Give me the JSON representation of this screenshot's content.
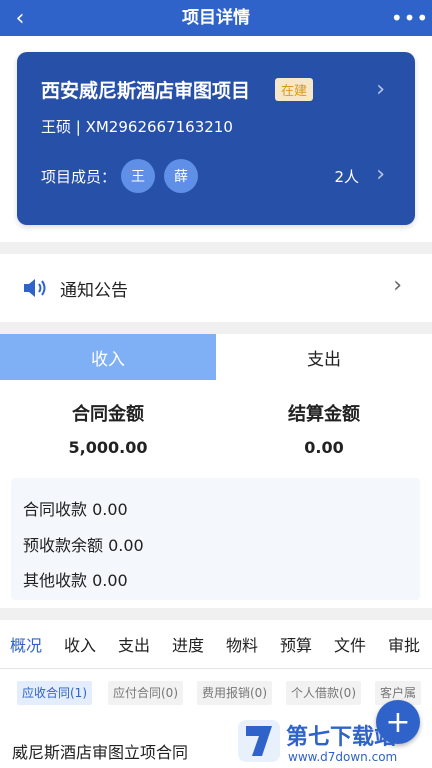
{
  "header": {
    "title": "项目详情",
    "back_glyph": "‹",
    "more_glyph": "•••"
  },
  "project": {
    "name": "西安威尼斯酒店审图项目",
    "status": "在建",
    "owner_line": "王硕 | XM2962667163210",
    "members_label": "项目成员：",
    "members": [
      "王",
      "薛"
    ],
    "member_count": "2人"
  },
  "notice": {
    "label": "通知公告"
  },
  "io_tabs": [
    {
      "label": "收入",
      "active": true
    },
    {
      "label": "支出",
      "active": false
    }
  ],
  "amounts": {
    "contract_label": "合同金额",
    "contract_value": "5,000.00",
    "settle_label": "结算金额",
    "settle_value": "0.00"
  },
  "summary": [
    "合同收款 0.00",
    "预收款余额 0.00",
    "其他收款 0.00"
  ],
  "subtabs": [
    "概况",
    "收入",
    "支出",
    "进度",
    "物料",
    "预算",
    "文件",
    "审批"
  ],
  "chips": [
    "应收合同(1)",
    "应付合同(0)",
    "费用报销(0)",
    "个人借款(0)",
    "客户属"
  ],
  "contract": {
    "title": "威尼斯酒店审图立项合同"
  },
  "fab": {
    "glyph": "+"
  },
  "watermark": {
    "brand": "第七下载站",
    "url": "www.d7down.com"
  },
  "colors": {
    "primary": "#2f63c9",
    "card": "#2750a8",
    "tab_active": "#7fb0f5",
    "status_text": "#e0961d"
  }
}
